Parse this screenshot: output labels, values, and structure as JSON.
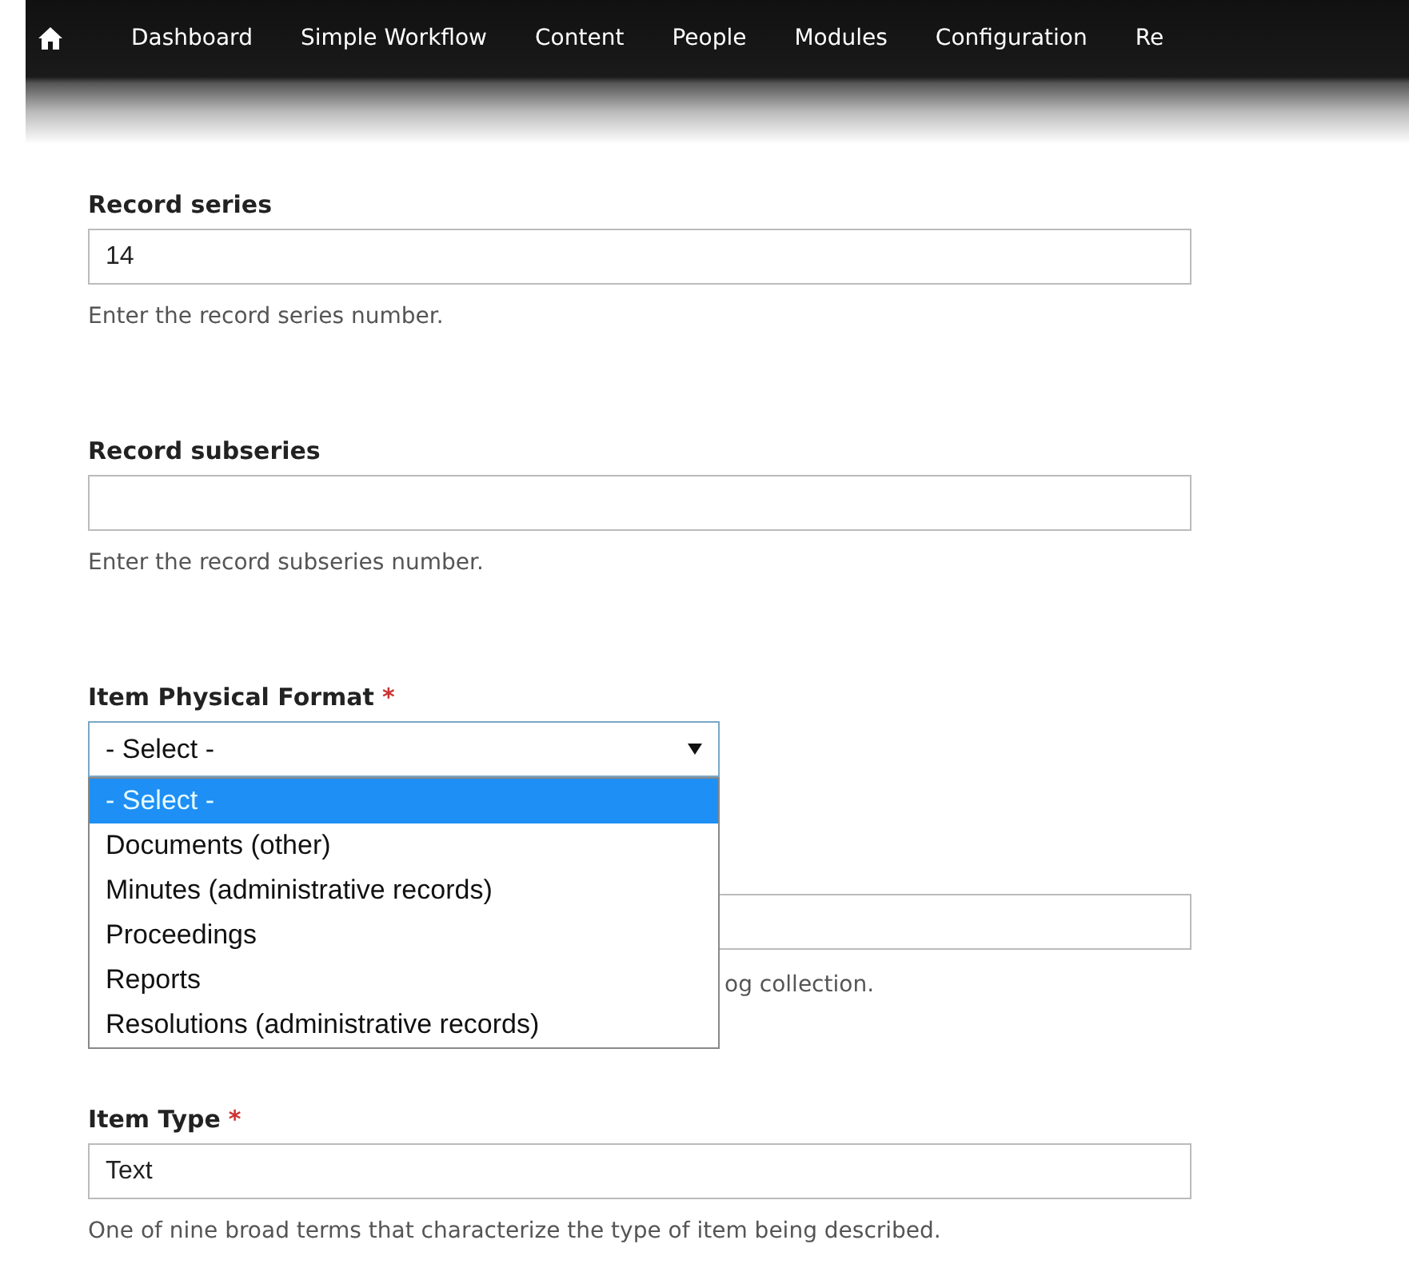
{
  "toolbar": {
    "items": [
      {
        "label": "Dashboard"
      },
      {
        "label": "Simple Workflow"
      },
      {
        "label": "Content"
      },
      {
        "label": "People"
      },
      {
        "label": "Modules"
      },
      {
        "label": "Configuration"
      },
      {
        "label": "Re"
      }
    ]
  },
  "fields": [
    {
      "kind": "text",
      "label": "Record series",
      "value": "14",
      "description": "Enter the record series number."
    },
    {
      "kind": "text",
      "label": "Record subseries",
      "description": "Enter the record subseries number."
    },
    {
      "kind": "select",
      "label": "Item Physical Format",
      "required_mark": "*",
      "value": "- Select -",
      "expanded": true,
      "options": [
        {
          "label": "- Select -",
          "selected": true
        },
        {
          "label": "Documents (other)",
          "selected": false
        },
        {
          "label": "Minutes (administrative records)",
          "selected": false
        },
        {
          "label": "Proceedings",
          "selected": false
        },
        {
          "label": "Reports",
          "selected": false
        },
        {
          "label": "Resolutions (administrative records)",
          "selected": false
        }
      ]
    },
    {
      "kind": "covered",
      "description": "og collection."
    },
    {
      "kind": "text",
      "label": "Item Type",
      "required_mark": "*",
      "value": "Text",
      "description": "One of nine broad terms that characterize the type of item being described."
    }
  ]
}
